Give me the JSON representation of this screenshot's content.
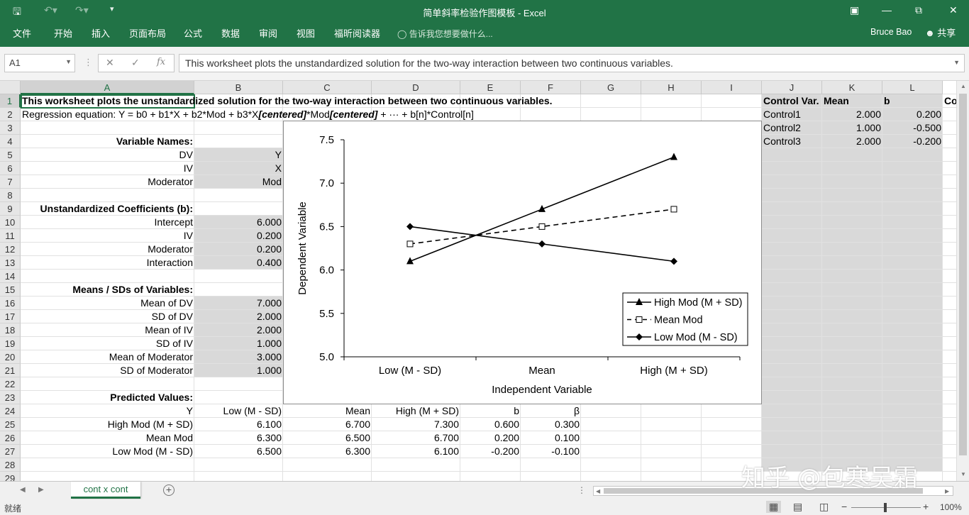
{
  "app": {
    "title": "简单斜率检验作图模板 - Excel",
    "user": "Bruce Bao",
    "share": "共享",
    "tabs": [
      "文件",
      "开始",
      "插入",
      "页面布局",
      "公式",
      "数据",
      "审阅",
      "视图",
      "福昕阅读器"
    ],
    "tell_me": "告诉我您想要做什么..."
  },
  "formula_bar": {
    "name_box": "A1",
    "fx": "fx",
    "content": "This worksheet plots the unstandardized solution for the two-way interaction between two continuous variables."
  },
  "columns": [
    "A",
    "B",
    "C",
    "D",
    "E",
    "F",
    "G",
    "H",
    "I",
    "J",
    "K",
    "L"
  ],
  "rows": [
    "1",
    "2",
    "3",
    "4",
    "5",
    "6",
    "7",
    "8",
    "9",
    "10",
    "11",
    "12",
    "13",
    "14",
    "15",
    "16",
    "17",
    "18",
    "19",
    "20",
    "21",
    "22",
    "23",
    "24",
    "25",
    "26",
    "27",
    "28",
    "29"
  ],
  "cells": {
    "A1": "This worksheet plots the unstandardized solution for the two-way interaction between two continuous variables.",
    "A2_pre": "Regression equation: Y = b0 + b1*X + b2*Mod + b3*X",
    "A2_c1": "[centered]",
    "A2_mid": "*Mod",
    "A2_c2": "[centered]",
    "A2_post": " + ··· + b[n]*Control[n]",
    "A4": "Variable Names:",
    "A5": "DV",
    "B5": "Y",
    "A6": "IV",
    "B6": "X",
    "A7": "Moderator",
    "B7": "Mod",
    "A9": "Unstandardized Coefficients (b):",
    "A10": "Intercept",
    "B10": "6.000",
    "A11": "IV",
    "B11": "0.200",
    "A12": "Moderator",
    "B12": "0.200",
    "A13": "Interaction",
    "B13": "0.400",
    "A15": "Means / SDs of Variables:",
    "A16": "Mean of DV",
    "B16": "7.000",
    "A17": "SD of DV",
    "B17": "2.000",
    "A18": "Mean of IV",
    "B18": "2.000",
    "A19": "SD of IV",
    "B19": "1.000",
    "A20": "Mean of Moderator",
    "B20": "3.000",
    "A21": "SD of Moderator",
    "B21": "1.000",
    "A23": "Predicted Values:",
    "A24": "Y",
    "B24": "Low (M - SD)",
    "C24": "Mean",
    "D24": "High (M + SD)",
    "E24": "b",
    "F24": "β",
    "A25": "High Mod (M + SD)",
    "B25": "6.100",
    "C25": "6.700",
    "D25": "7.300",
    "E25": "0.600",
    "F25": "0.300",
    "A26": "Mean Mod",
    "B26": "6.300",
    "C26": "6.500",
    "D26": "6.700",
    "E26": "0.200",
    "F26": "0.100",
    "A27": "Low Mod (M - SD)",
    "B27": "6.500",
    "C27": "6.300",
    "D27": "6.100",
    "E27": "-0.200",
    "F27": "-0.100",
    "J1": "Control Var.",
    "K1": "Mean",
    "L1": "b",
    "M1": "Co",
    "J2": "Control1",
    "K2": "2.000",
    "L2": "0.200",
    "J3": "Control2",
    "K3": "1.000",
    "L3": "-0.500",
    "J4": "Control3",
    "K4": "2.000",
    "L4": "-0.200"
  },
  "chart_data": {
    "type": "line",
    "categories": [
      "Low (M - SD)",
      "Mean",
      "High (M + SD)"
    ],
    "series": [
      {
        "name": "High Mod (M + SD)",
        "values": [
          6.1,
          6.7,
          7.3
        ],
        "marker": "triangle",
        "dash": "solid"
      },
      {
        "name": "Mean Mod",
        "values": [
          6.3,
          6.5,
          6.7
        ],
        "marker": "square-open",
        "dash": "dashed"
      },
      {
        "name": "Low Mod (M - SD)",
        "values": [
          6.5,
          6.3,
          6.1
        ],
        "marker": "diamond",
        "dash": "solid"
      }
    ],
    "xlabel": "Independent Variable",
    "ylabel": "Dependent Variable",
    "ylim": [
      5.0,
      7.5
    ],
    "yticks": [
      "5.0",
      "5.5",
      "6.0",
      "6.5",
      "7.0",
      "7.5"
    ],
    "legend_position": "bottom-right",
    "grid": false
  },
  "sheet_tab": "cont x cont",
  "status": {
    "ready": "就绪",
    "zoom": "100%"
  },
  "watermark": "知乎 @包寒吴霜"
}
